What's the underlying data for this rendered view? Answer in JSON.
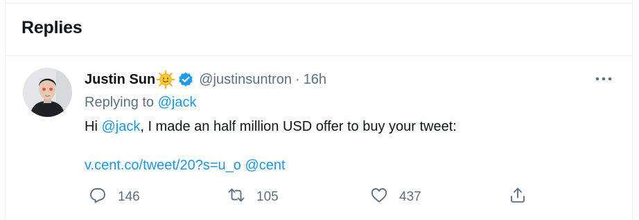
{
  "section": {
    "title": "Replies"
  },
  "tweet": {
    "author_name": "Justin Sun",
    "handle": "@justinsuntron",
    "separator": "·",
    "time": "16h",
    "replying_prefix": "Replying to ",
    "replying_to": "@jack",
    "text_before": "Hi ",
    "text_mention": "@jack",
    "text_after": ", I made an half million USD offer to buy your tweet:",
    "link": "v.cent.co/tweet/20?s=u_o @cent",
    "icons": {
      "name_emoji": "sun-emoji-icon",
      "verified": "verified-badge-icon",
      "more": "more-icon"
    }
  },
  "actions": {
    "reply": {
      "icon": "reply-icon",
      "count": "146"
    },
    "retweet": {
      "icon": "retweet-icon",
      "count": "105"
    },
    "like": {
      "icon": "like-icon",
      "count": "437"
    },
    "share": {
      "icon": "share-icon"
    }
  },
  "colors": {
    "accent": "#1b95e0",
    "secondary_text": "#5b7083",
    "primary_text": "#0f1419",
    "divider": "#ebeef0"
  }
}
